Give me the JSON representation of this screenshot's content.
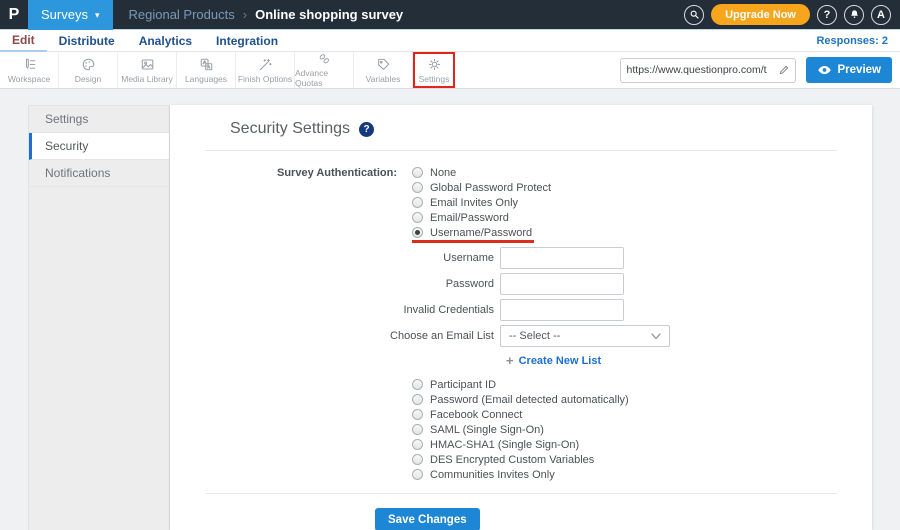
{
  "topbar": {
    "logo_letter": "P",
    "product_menu": "Surveys",
    "caret_icon": "▾",
    "breadcrumb": {
      "folder": "Regional Products",
      "separator": "›",
      "survey": "Online shopping survey"
    },
    "upgrade_button": "Upgrade Now",
    "help_button": "?",
    "avatar_initial": "A",
    "colors": {
      "bar": "#242e39",
      "accent_blue": "#2c97dd",
      "upgrade_orange": "#f7a51c"
    }
  },
  "nav": {
    "items": [
      {
        "label": "Edit",
        "active": true
      },
      {
        "label": "Distribute",
        "active": false
      },
      {
        "label": "Analytics",
        "active": false
      },
      {
        "label": "Integration",
        "active": false
      }
    ],
    "responses_label": "Responses: 2"
  },
  "toolbar": {
    "items": [
      {
        "label": "Workspace",
        "icon": "pencil-list"
      },
      {
        "label": "Design",
        "icon": "palette"
      },
      {
        "label": "Media Library",
        "icon": "image"
      },
      {
        "label": "Languages",
        "icon": "translate"
      },
      {
        "label": "Finish Options",
        "icon": "magic-wand"
      },
      {
        "label": "Advance Quotas",
        "icon": "chain-links"
      },
      {
        "label": "Variables",
        "icon": "tag"
      },
      {
        "label": "Settings",
        "icon": "gear",
        "highlighted": true
      }
    ],
    "annotation_color": "#e3241b",
    "url_value": "https://www.questionpro.com/t/APNrFZ",
    "preview_button": "Preview"
  },
  "sidebar": {
    "items": [
      {
        "label": "Settings",
        "active": false
      },
      {
        "label": "Security",
        "active": true
      },
      {
        "label": "Notifications",
        "active": false
      }
    ]
  },
  "main": {
    "title": "Security Settings",
    "help_icon": "?",
    "auth_label": "Survey Authentication:",
    "auth_options_top": [
      {
        "label": "None",
        "checked": false
      },
      {
        "label": "Global Password Protect",
        "checked": false
      },
      {
        "label": "Email Invites Only",
        "checked": false
      },
      {
        "label": "Email/Password",
        "checked": false
      },
      {
        "label": "Username/Password",
        "checked": true,
        "annotation": "red-underline"
      }
    ],
    "fields": [
      {
        "label": "Username",
        "value": ""
      },
      {
        "label": "Password",
        "value": ""
      },
      {
        "label": "Invalid Credentials",
        "value": ""
      }
    ],
    "email_list": {
      "label": "Choose an Email List",
      "selected": "-- Select --"
    },
    "create_list": {
      "plus_icon": "+",
      "label": "Create New List"
    },
    "auth_options_bottom": [
      {
        "label": "Participant ID"
      },
      {
        "label": "Password (Email detected automatically)"
      },
      {
        "label": "Facebook Connect"
      },
      {
        "label": "SAML (Single Sign-On)"
      },
      {
        "label": "HMAC-SHA1 (Single Sign-On)"
      },
      {
        "label": "DES Encrypted Custom Variables"
      },
      {
        "label": "Communities Invites Only"
      }
    ],
    "save_button": "Save Changes"
  }
}
